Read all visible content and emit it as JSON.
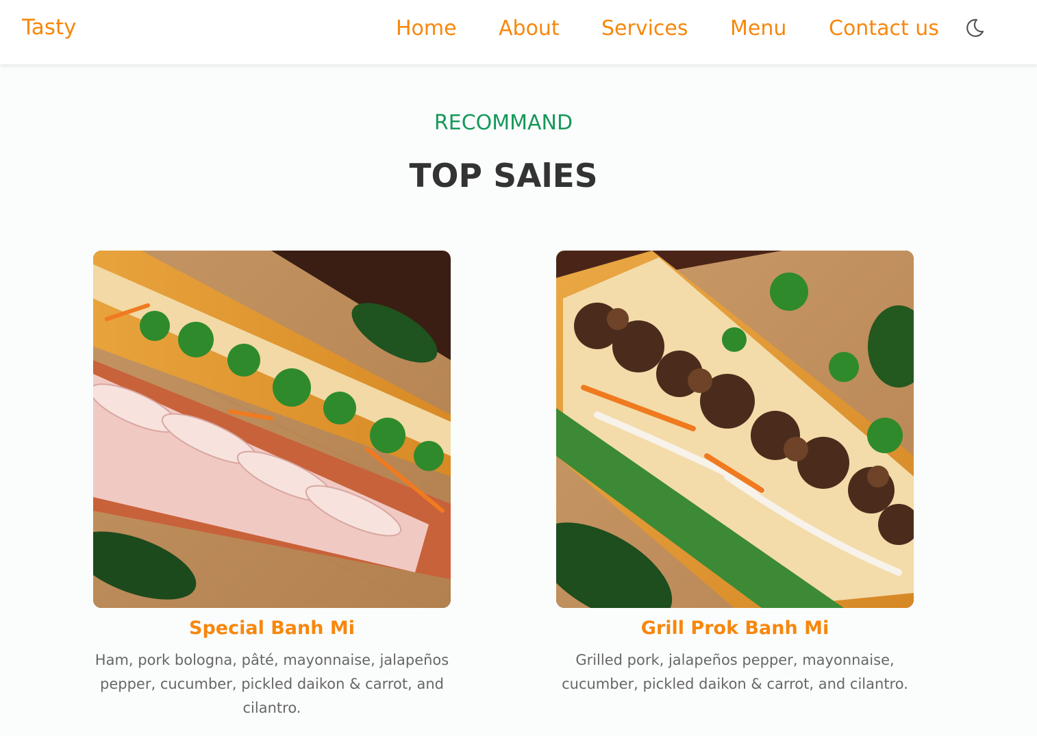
{
  "header": {
    "logo": "Tasty",
    "nav": [
      "Home",
      "About",
      "Services",
      "Menu",
      "Contact us"
    ],
    "theme_icon": "moon-icon"
  },
  "section": {
    "subtitle": "RECOMMAND",
    "title": "TOP SAlES"
  },
  "products": [
    {
      "name": "Special Banh Mi",
      "description": "Ham, pork bologna, pâté, mayonnaise, jalapeños pepper, cucumber, pickled daikon & carrot, and cilantro."
    },
    {
      "name": "Grill Prok Banh Mi",
      "description": "Grilled pork, jalapeños pepper, mayonnaise, cucumber, pickled daikon & carrot, and cilantro."
    }
  ],
  "colors": {
    "accent": "#f7870d",
    "subtitle": "#16985a",
    "title": "#333333",
    "text": "#666666"
  }
}
